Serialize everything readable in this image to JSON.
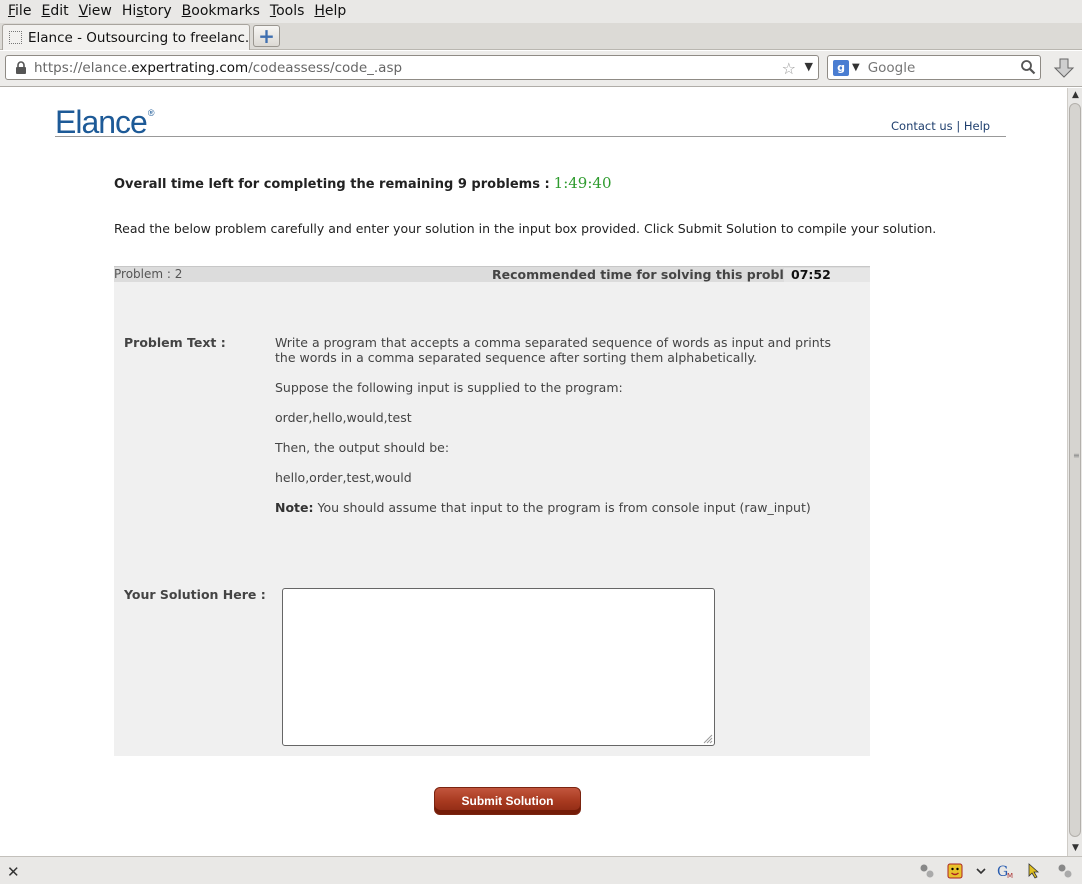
{
  "browser": {
    "menu": [
      "File",
      "Edit",
      "View",
      "History",
      "Bookmarks",
      "Tools",
      "Help"
    ],
    "menu_underline": [
      "F",
      "E",
      "V",
      "s",
      "B",
      "T",
      "H"
    ],
    "tab_title": "Elance - Outsourcing to freelanc...",
    "newtab_symbol": "+",
    "url_prefix": "https://elance.",
    "url_domain": "expertrating.com",
    "url_path": "/codeassess/code_.asp",
    "search_placeholder": "Google",
    "search_engine_badge": "g"
  },
  "header": {
    "logo_text": "Elance",
    "logo_reg": "®",
    "contact_link": "Contact us",
    "separator": "|",
    "help_link": "Help"
  },
  "timer": {
    "label": "Overall time left for completing the remaining 9 problems :",
    "value": "1:49:40"
  },
  "instructions": "Read the below problem carefully and enter your solution in the input box provided. Click Submit Solution to compile your solution.",
  "problem": {
    "number_label": "Problem : 2",
    "recommended_label": "Recommended time for solving this problem :",
    "recommended_time": "07:52",
    "text_label": "Problem Text :",
    "paragraphs": [
      "Write a program that accepts a comma separated sequence of words as input and prints the words in a comma separated sequence after sorting them alphabetically.",
      "Suppose the following input is supplied to the program:",
      "order,hello,would,test",
      "Then, the output should be:",
      "hello,order,test,would"
    ],
    "note_label": "Note:",
    "note_text": " You should assume that input to the program is from console input (raw_input)",
    "solution_label": "Your Solution Here :",
    "solution_value": ""
  },
  "submit_label": "Submit Solution",
  "icons": {
    "lock": "lock-icon",
    "star": "bookmark-star-icon",
    "magnifier": "search-icon",
    "download": "download-arrow-icon"
  }
}
